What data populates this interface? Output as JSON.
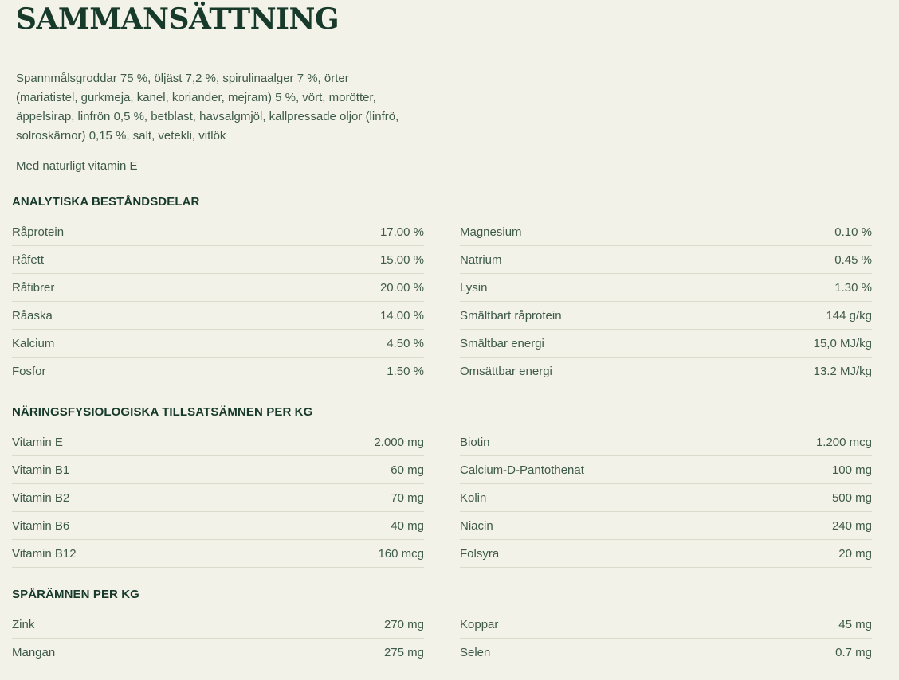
{
  "title": "SAMMANSÄTTNING",
  "composition_text": "Spannmålsgroddar 75 %, öljäst 7,2 %, spirulinaalger 7 %, örter (mariatistel, gurkmeja, kanel, koriander, mejram) 5 %, vört, morötter, äppelsirap, linfrön 0,5 %, betblast, havsalgmjöl, kallpressade oljor (linfrö, solroskärnor) 0,15 %, salt, vetekli, vitlök",
  "composition_lines": [
    "Spannmålsgroddar 75 %, öljäst 7,2 %, spirulinaalger 7 %, örter",
    "(mariatistel, gurkmeja, kanel, koriander, mejram) 5 %, vört, morötter,",
    "äppelsirap, linfrön 0,5 %, betblast, havsalgmjöl, kallpressade oljor (linfrö,",
    "solroskärnor) 0,15 %, salt, vetekli, vitlök"
  ],
  "vitamin_note": "Med naturligt vitamin E",
  "sections": [
    {
      "heading": "ANALYTISKA BESTÅNDSDELAR",
      "left": [
        {
          "label": "Råprotein",
          "value": "17.00 %"
        },
        {
          "label": "Råfett",
          "value": "15.00 %"
        },
        {
          "label": "Råfibrer",
          "value": "20.00 %"
        },
        {
          "label": "Råaska",
          "value": "14.00 %"
        },
        {
          "label": "Kalcium",
          "value": "4.50 %"
        },
        {
          "label": "Fosfor",
          "value": "1.50 %"
        }
      ],
      "right": [
        {
          "label": "Magnesium",
          "value": "0.10 %"
        },
        {
          "label": "Natrium",
          "value": "0.45 %"
        },
        {
          "label": "Lysin",
          "value": "1.30 %"
        },
        {
          "label": "Smältbart råprotein",
          "value": "144 g/kg"
        },
        {
          "label": "Smältbar energi",
          "value": "15,0 MJ/kg"
        },
        {
          "label": "Omsättbar energi",
          "value": "13.2 MJ/kg"
        }
      ]
    },
    {
      "heading": "NÄRINGSFYSIOLOGISKA TILLSATSÄMNEN PER KG",
      "left": [
        {
          "label": "Vitamin E",
          "value": "2.000 mg"
        },
        {
          "label": "Vitamin B1",
          "value": "60 mg"
        },
        {
          "label": "Vitamin B2",
          "value": "70 mg"
        },
        {
          "label": "Vitamin B6",
          "value": "40 mg"
        },
        {
          "label": "Vitamin B12",
          "value": "160 mcg"
        }
      ],
      "right": [
        {
          "label": "Biotin",
          "value": "1.200 mcg"
        },
        {
          "label": "Calcium-D-Pantothenat",
          "value": "100 mg"
        },
        {
          "label": "Kolin",
          "value": "500 mg"
        },
        {
          "label": "Niacin",
          "value": "240 mg"
        },
        {
          "label": "Folsyra",
          "value": "20 mg"
        }
      ]
    },
    {
      "heading": "SPÅRÄMNEN PER KG",
      "left": [
        {
          "label": "Zink",
          "value": "270 mg"
        },
        {
          "label": "Mangan",
          "value": "275 mg"
        }
      ],
      "right": [
        {
          "label": "Koppar",
          "value": "45 mg"
        },
        {
          "label": "Selen",
          "value": "0.7 mg"
        }
      ]
    }
  ]
}
